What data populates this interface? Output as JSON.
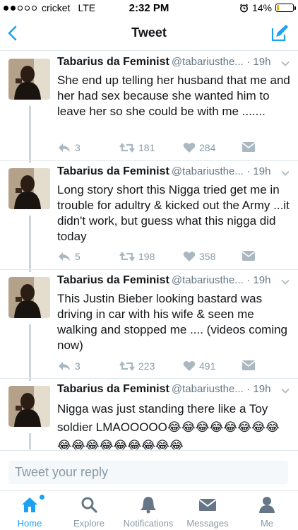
{
  "status_bar": {
    "carrier": "cricket",
    "network": "LTE",
    "time": "2:32 PM",
    "battery_percent": "14%",
    "battery_level": 0.14,
    "battery_color": "#e6b800",
    "signal_bars_filled": 2
  },
  "nav": {
    "title": "Tweet",
    "back_icon": "chevron-left-icon",
    "compose_icon": "compose-icon"
  },
  "tweets": [
    {
      "name": "Tabarius da Feminist",
      "handle": "@tabariusthe...",
      "time": "· 19h",
      "text": "She end up telling her husband that me and her had sex because she wanted him to leave her so she could be with me .......",
      "replies": "3",
      "retweets": "181",
      "likes": "284"
    },
    {
      "name": "Tabarius da Feminist",
      "handle": "@tabariusthe...",
      "time": "· 19h",
      "text": "Long story short this Nigga tried get me in trouble for adultry & kicked out the Army ...it didn't work, but guess what this nigga did today",
      "replies": "5",
      "retweets": "198",
      "likes": "358"
    },
    {
      "name": "Tabarius da Feminist",
      "handle": "@tabariusthe...",
      "time": "· 19h",
      "text": "This Justin Bieber looking bastard was driving in car with his wife & seen me walking and stopped me .... (videos coming now)",
      "replies": "3",
      "retweets": "223",
      "likes": "491"
    },
    {
      "name": "Tabarius da Feminist",
      "handle": "@tabariusthe...",
      "time": "· 19h",
      "text": "Nigga was just standing there like a Toy soldier LMAOOOOO😂😂😂😂😂😂😂😂😂😂😂😂😂😂😂😂😂"
    }
  ],
  "reply": {
    "placeholder": "Tweet your reply"
  },
  "tabs": [
    {
      "label": "Home",
      "icon": "home-icon",
      "active": true
    },
    {
      "label": "Explore",
      "icon": "search-icon",
      "active": false
    },
    {
      "label": "Notifications",
      "icon": "bell-icon",
      "active": false
    },
    {
      "label": "Messages",
      "icon": "envelope-icon",
      "active": false
    },
    {
      "label": "Me",
      "icon": "person-icon",
      "active": false
    }
  ],
  "colors": {
    "accent": "#1da1f2",
    "text": "#14171a",
    "muted": "#657786",
    "action_gray": "#8899a6"
  }
}
